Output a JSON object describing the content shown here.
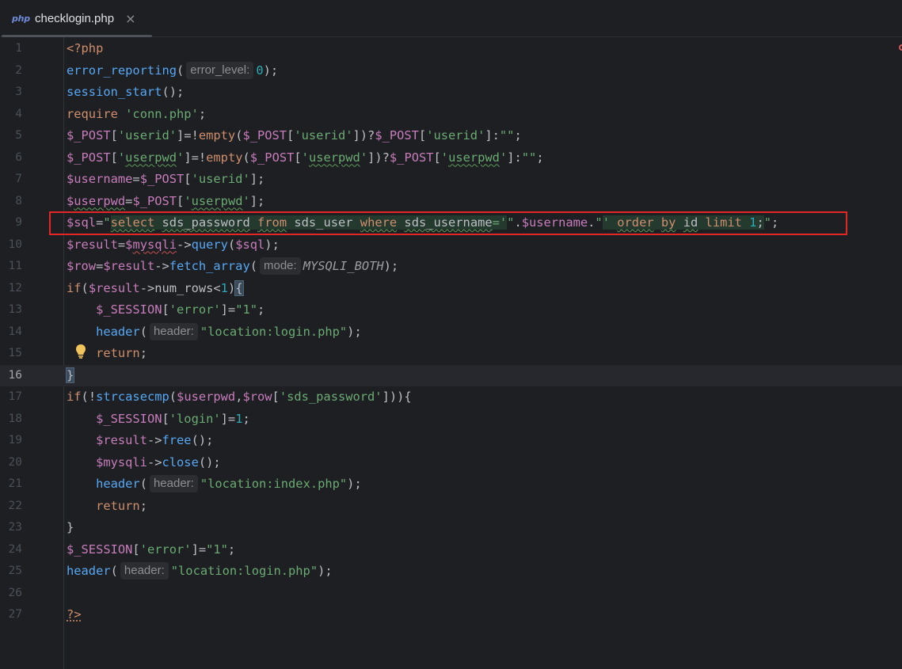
{
  "tab": {
    "icon": "php",
    "title": "checklogin.php",
    "close": "×"
  },
  "hints": {
    "error_level": "error_level:",
    "mode": "mode:",
    "header": "header:"
  },
  "lines": [
    "1",
    "2",
    "3",
    "4",
    "5",
    "6",
    "7",
    "8",
    "9",
    "10",
    "11",
    "12",
    "13",
    "14",
    "15",
    "16",
    "17",
    "18",
    "19",
    "20",
    "21",
    "22",
    "23",
    "24",
    "25",
    "26",
    "27"
  ],
  "current_line": 16,
  "colors": {
    "background": "#1e1f22",
    "keyword": "#cf8e6d",
    "function": "#56a8f5",
    "variable": "#c77dbb",
    "string": "#6aab73",
    "number": "#2aacb8",
    "highlight_box": "#e32626"
  },
  "icons": [
    "php-icon",
    "close-icon",
    "bulb-icon"
  ]
}
